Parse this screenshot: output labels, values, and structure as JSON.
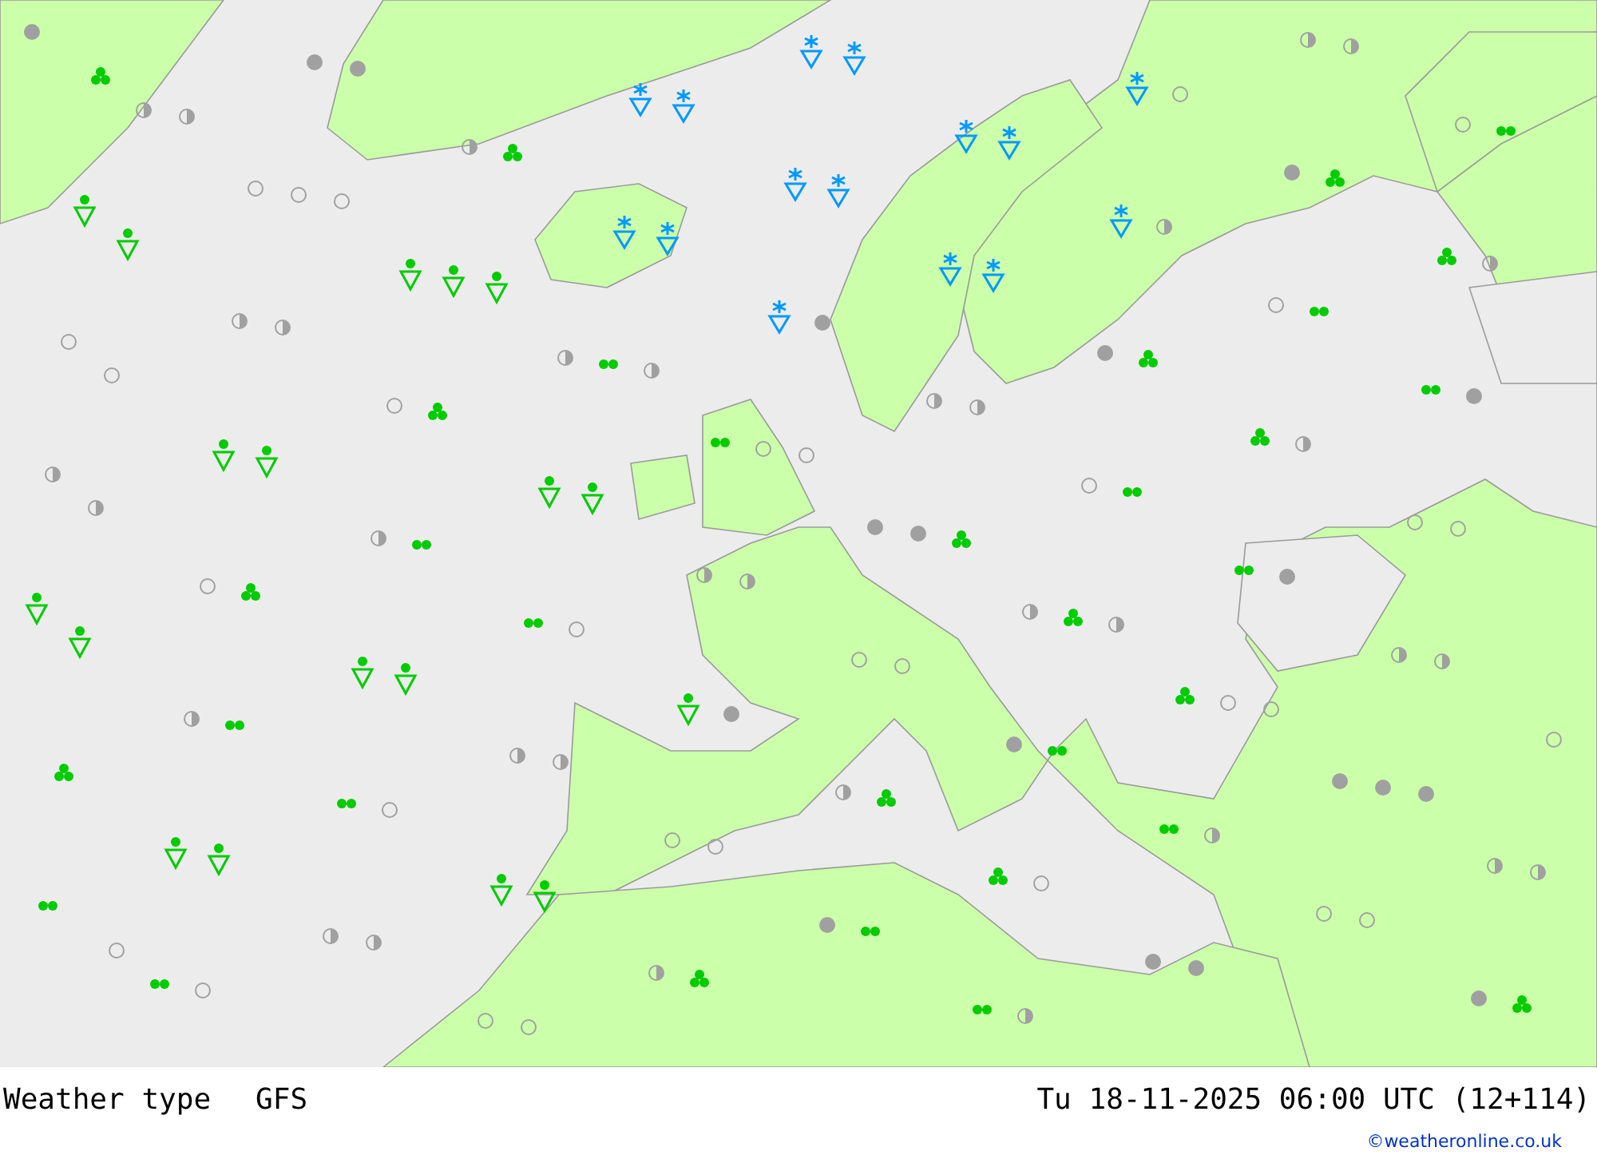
{
  "map": {
    "title": "Weather type",
    "model": "GFS",
    "valid_time": "Tu 18-11-2025 06:00 UTC (12+114)"
  },
  "credit": "©weatheronline.co.uk"
}
